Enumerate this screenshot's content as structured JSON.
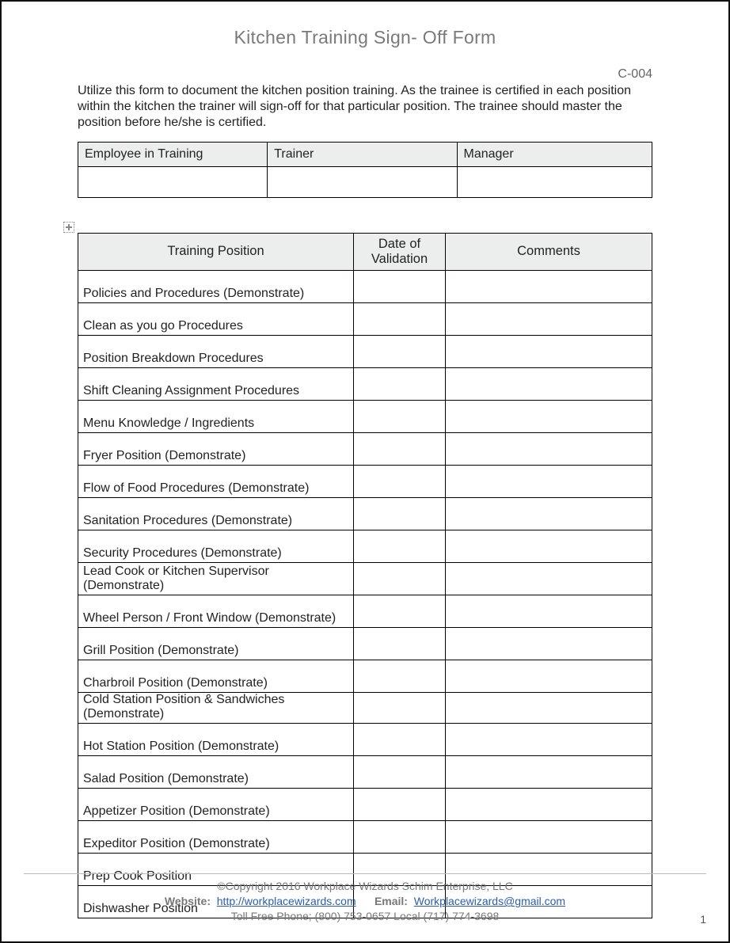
{
  "title": "Kitchen Training Sign- Off Form",
  "form_code": "C-004",
  "intro": "Utilize this form to document the kitchen position training. As the trainee is certified in each position within the kitchen the trainer will sign-off for that particular position. The trainee should master the position before he/she is certified.",
  "meta_table": {
    "headers": [
      "Employee in Training",
      "Trainer",
      "Manager"
    ],
    "values": [
      "",
      "",
      ""
    ]
  },
  "training_table": {
    "headers": {
      "position": "Training Position",
      "date": "Date of Validation",
      "comments": "Comments"
    },
    "rows": [
      {
        "position": "Policies and Procedures (Demonstrate)",
        "date": "",
        "comments": ""
      },
      {
        "position": "Clean as you go Procedures",
        "date": "",
        "comments": ""
      },
      {
        "position": "Position Breakdown Procedures",
        "date": "",
        "comments": ""
      },
      {
        "position": "Shift Cleaning Assignment Procedures",
        "date": "",
        "comments": ""
      },
      {
        "position": "Menu Knowledge / Ingredients",
        "date": "",
        "comments": ""
      },
      {
        "position": "Fryer Position (Demonstrate)",
        "date": "",
        "comments": ""
      },
      {
        "position": "Flow of Food Procedures (Demonstrate)",
        "date": "",
        "comments": ""
      },
      {
        "position": "Sanitation Procedures (Demonstrate)",
        "date": "",
        "comments": ""
      },
      {
        "position": "Security Procedures (Demonstrate)",
        "date": "",
        "comments": ""
      },
      {
        "position": "Lead Cook or Kitchen Supervisor (Demonstrate)",
        "date": "",
        "comments": ""
      },
      {
        "position": "Wheel Person / Front Window (Demonstrate)",
        "date": "",
        "comments": ""
      },
      {
        "position": "Grill Position (Demonstrate)",
        "date": "",
        "comments": ""
      },
      {
        "position": "Charbroil Position (Demonstrate)",
        "date": "",
        "comments": ""
      },
      {
        "position": "Cold Station Position & Sandwiches (Demonstrate)",
        "date": "",
        "comments": "",
        "short": true
      },
      {
        "position": "Hot Station Position (Demonstrate)",
        "date": "",
        "comments": ""
      },
      {
        "position": "Salad Position (Demonstrate)",
        "date": "",
        "comments": ""
      },
      {
        "position": "Appetizer Position (Demonstrate)",
        "date": "",
        "comments": ""
      },
      {
        "position": "Expeditor Position (Demonstrate)",
        "date": "",
        "comments": ""
      },
      {
        "position": "Prep Cook Position",
        "date": "",
        "comments": ""
      },
      {
        "position": "Dishwasher Position",
        "date": "",
        "comments": ""
      }
    ]
  },
  "footer": {
    "copyright": "©Copyright 2016 Workplace Wizards Schim Enterprise, LLC",
    "website_label": "Website:",
    "website_url_text": "http://workplacewizards.com",
    "email_label": "Email:",
    "email_text": "Workplacewizards@gmail.com",
    "phone_line": "Toll Free Phone; (800) 753-0657 Local (717) 774-3698",
    "page_number": "1"
  }
}
